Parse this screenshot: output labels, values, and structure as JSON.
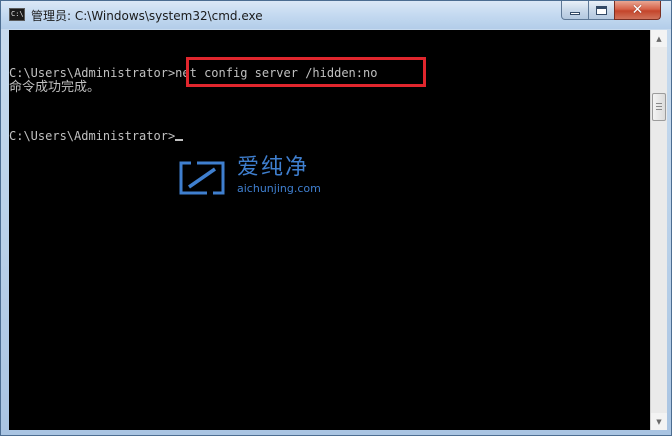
{
  "window": {
    "title": "管理员: C:\\Windows\\system32\\cmd.exe",
    "icon_text": "C:\\",
    "controls": {
      "minimize_icon": "minimize-icon",
      "maximize_icon": "maximize-icon",
      "close_icon": "close-icon",
      "close_glyph": "✕"
    }
  },
  "console": {
    "lines": [
      "C:\\Users\\Administrator>net config server /hidden:no",
      "命令成功完成。",
      "C:\\Users\\Administrator>"
    ],
    "highlighted_command": "net config server /hidden:no",
    "highlight_color": "#e0262d",
    "text_color": "#c0c0c0",
    "background_color": "#000000"
  },
  "watermark": {
    "title": "爱纯净",
    "url": "aichunjing.com",
    "color": "#3f7fcf"
  },
  "scrollbar": {
    "up_arrow": "▲",
    "down_arrow": "▼"
  }
}
